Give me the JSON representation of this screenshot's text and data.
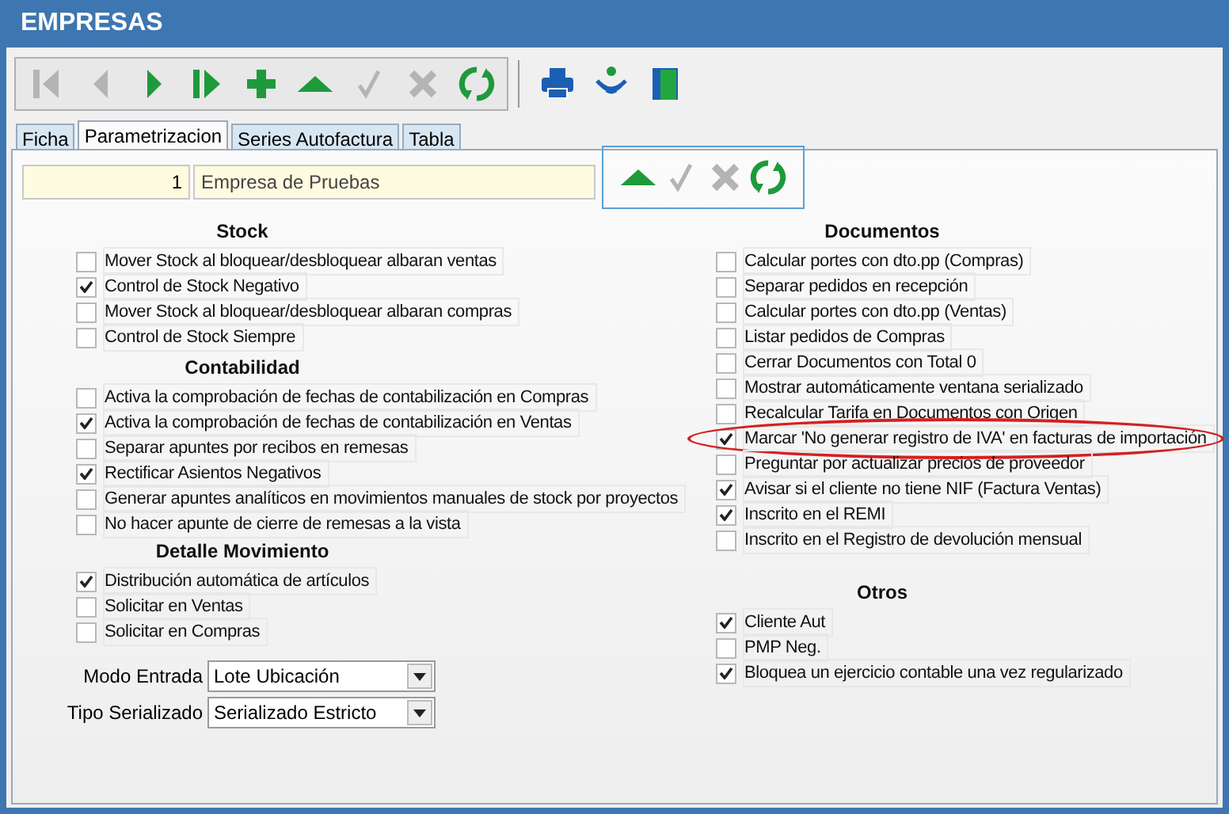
{
  "window": {
    "title": "EMPRESAS"
  },
  "toolbar": [
    {
      "kind": "first",
      "disabled": true
    },
    {
      "kind": "prev",
      "disabled": true
    },
    {
      "kind": "next",
      "disabled": false
    },
    {
      "kind": "last",
      "disabled": false
    },
    {
      "kind": "add",
      "disabled": false
    },
    {
      "kind": "up",
      "disabled": false
    },
    {
      "kind": "accept",
      "disabled": true
    },
    {
      "kind": "cancel",
      "disabled": true
    },
    {
      "kind": "refresh",
      "disabled": false
    }
  ],
  "toolbar_extra": [
    {
      "kind": "print"
    },
    {
      "kind": "signal"
    },
    {
      "kind": "exit"
    }
  ],
  "tabs": [
    {
      "label": "Ficha",
      "selected": false
    },
    {
      "label": "Parametrizacion",
      "selected": true
    },
    {
      "label": "Series Autofactura",
      "selected": false
    },
    {
      "label": "Tabla",
      "selected": false
    }
  ],
  "record": {
    "code": "1",
    "name": "Empresa de Pruebas"
  },
  "record_toolbar": [
    {
      "kind": "up",
      "disabled": false
    },
    {
      "kind": "accept",
      "disabled": true
    },
    {
      "kind": "cancel",
      "disabled": true
    },
    {
      "kind": "refresh",
      "disabled": false
    }
  ],
  "left_sections": [
    {
      "title": "Stock",
      "items": [
        {
          "label": "Mover Stock al bloquear/desbloquear albaran ventas",
          "checked": false
        },
        {
          "label": "Control de Stock Negativo",
          "checked": true
        },
        {
          "label": "Mover Stock al bloquear/desbloquear albaran compras",
          "checked": false
        },
        {
          "label": "Control de Stock Siempre",
          "checked": false
        }
      ]
    },
    {
      "title": "Contabilidad",
      "items": [
        {
          "label": "Activa la comprobación de fechas de contabilización en Compras",
          "checked": false
        },
        {
          "label": "Activa la comprobación de fechas de contabilización en Ventas",
          "checked": true
        },
        {
          "label": "Separar apuntes por recibos en remesas",
          "checked": false
        },
        {
          "label": "Rectificar Asientos Negativos",
          "checked": true
        },
        {
          "label": "Generar apuntes analíticos en movimientos manuales de stock por proyectos",
          "checked": false
        },
        {
          "label": "No hacer apunte de cierre de remesas a la vista",
          "checked": false
        }
      ]
    },
    {
      "title": "Detalle Movimiento",
      "items": [
        {
          "label": "Distribución automática de artículos",
          "checked": true
        },
        {
          "label": "Solicitar en Ventas",
          "checked": false
        },
        {
          "label": "Solicitar en Compras",
          "checked": false
        }
      ]
    }
  ],
  "selects": [
    {
      "label": "Modo Entrada",
      "value": "Lote Ubicación"
    },
    {
      "label": "Tipo Serializado",
      "value": "Serializado Estricto"
    }
  ],
  "right_sections": [
    {
      "title": "Documentos",
      "items": [
        {
          "label": "Calcular portes con dto.pp (Compras)",
          "checked": false,
          "highlighted": false
        },
        {
          "label": "Separar pedidos en recepción",
          "checked": false,
          "highlighted": false
        },
        {
          "label": "Calcular portes con dto.pp (Ventas)",
          "checked": false,
          "highlighted": false
        },
        {
          "label": "Listar pedidos de Compras",
          "checked": false,
          "highlighted": false
        },
        {
          "label": "Cerrar Documentos con Total 0",
          "checked": false,
          "highlighted": false
        },
        {
          "label": "Mostrar automáticamente ventana serializado",
          "checked": false,
          "highlighted": false
        },
        {
          "label": "Recalcular Tarifa en Documentos con Origen",
          "checked": false,
          "highlighted": false
        },
        {
          "label": "Marcar 'No generar registro de IVA' en facturas de importación",
          "checked": true,
          "highlighted": true
        },
        {
          "label": "Preguntar por actualizar precios de proveedor",
          "checked": false,
          "highlighted": false
        },
        {
          "label": "Avisar si el cliente no tiene NIF (Factura Ventas)",
          "checked": true,
          "highlighted": false
        },
        {
          "label": "Inscrito en el REMI",
          "checked": true,
          "highlighted": false
        },
        {
          "label": "Inscrito en el Registro de devolución mensual",
          "checked": false,
          "highlighted": false
        }
      ]
    },
    {
      "title": "Otros",
      "items": [
        {
          "label": "Cliente Aut",
          "checked": true,
          "highlighted": false
        },
        {
          "label": "PMP Neg.",
          "checked": false,
          "highlighted": false
        },
        {
          "label": "Bloquea un ejercicio contable una vez regularizado",
          "checked": true,
          "highlighted": false
        }
      ]
    }
  ]
}
